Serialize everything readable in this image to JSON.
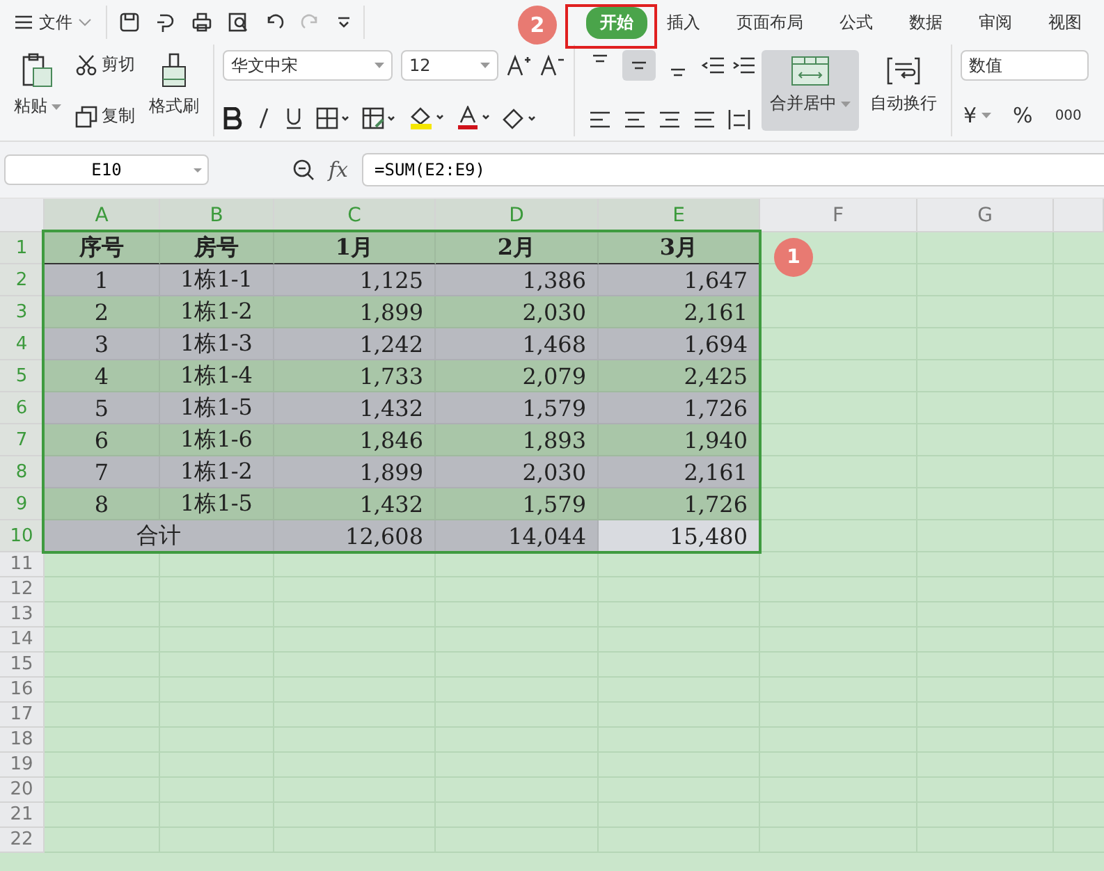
{
  "menu": {
    "label": "文件"
  },
  "tabs": [
    {
      "label": "开始",
      "selected": true
    },
    {
      "label": "插入",
      "selected": false
    },
    {
      "label": "页面布局",
      "selected": false
    },
    {
      "label": "公式",
      "selected": false
    },
    {
      "label": "数据",
      "selected": false
    },
    {
      "label": "审阅",
      "selected": false
    },
    {
      "label": "视图",
      "selected": false
    }
  ],
  "tab_badge": "2",
  "clipboard": {
    "paste": "粘贴",
    "cut": "剪切",
    "copy": "复制",
    "format_painter": "格式刷"
  },
  "font": {
    "name": "华文中宋",
    "size": "12"
  },
  "vertical_align": [
    {
      "selected": false
    },
    {
      "selected": true
    },
    {
      "selected": false
    }
  ],
  "merge": {
    "label": "合并居中",
    "selected": true
  },
  "wrap": {
    "label": "自动换行"
  },
  "number": {
    "format": "数值",
    "currency": "¥",
    "percent": "%",
    "thousands": "000"
  },
  "formula_bar": {
    "cell": "E10",
    "fx": "fx",
    "formula": "=SUM(E2:E9)"
  },
  "sheet": {
    "columns": [
      {
        "label": "A",
        "selected": true
      },
      {
        "label": "B",
        "selected": true
      },
      {
        "label": "C",
        "selected": true
      },
      {
        "label": "D",
        "selected": true
      },
      {
        "label": "E",
        "selected": true
      },
      {
        "label": "F",
        "selected": false
      },
      {
        "label": "G",
        "selected": false
      }
    ],
    "rows": [
      {
        "num": "1",
        "kind": "header",
        "color": "#a9c6a8",
        "cells": [
          "序号",
          "房号",
          "1月",
          "2月",
          "3月"
        ]
      },
      {
        "num": "2",
        "kind": "data",
        "color": "#b8bac0",
        "cells": [
          "1",
          "1栋1-1",
          "1,125",
          "1,386",
          "1,647"
        ]
      },
      {
        "num": "3",
        "kind": "data",
        "color": "#a9c6a8",
        "cells": [
          "2",
          "1栋1-2",
          "1,899",
          "2,030",
          "2,161"
        ]
      },
      {
        "num": "4",
        "kind": "data",
        "color": "#b8bac0",
        "cells": [
          "3",
          "1栋1-3",
          "1,242",
          "1,468",
          "1,694"
        ]
      },
      {
        "num": "5",
        "kind": "data",
        "color": "#a9c6a8",
        "cells": [
          "4",
          "1栋1-4",
          "1,733",
          "2,079",
          "2,425"
        ]
      },
      {
        "num": "6",
        "kind": "data",
        "color": "#b8bac0",
        "cells": [
          "5",
          "1栋1-5",
          "1,432",
          "1,579",
          "1,726"
        ]
      },
      {
        "num": "7",
        "kind": "data",
        "color": "#a9c6a8",
        "cells": [
          "6",
          "1栋1-6",
          "1,846",
          "1,893",
          "1,940"
        ]
      },
      {
        "num": "8",
        "kind": "data",
        "color": "#b8bac0",
        "cells": [
          "7",
          "1栋1-2",
          "1,899",
          "2,030",
          "2,161"
        ]
      },
      {
        "num": "9",
        "kind": "data",
        "color": "#a9c6a8",
        "cells": [
          "8",
          "1栋1-5",
          "1,432",
          "1,579",
          "1,726"
        ]
      },
      {
        "num": "10",
        "kind": "total",
        "color": "#b8bac0",
        "label": "合计",
        "values": [
          {
            "text": "12,608",
            "selected": false
          },
          {
            "text": "14,044",
            "selected": false
          },
          {
            "text": "15,480",
            "selected": true
          }
        ]
      }
    ],
    "empty_rows": [
      "11",
      "12",
      "13",
      "14",
      "15",
      "16",
      "17",
      "18",
      "19",
      "20",
      "21",
      "22"
    ],
    "selection_badge": "1"
  }
}
